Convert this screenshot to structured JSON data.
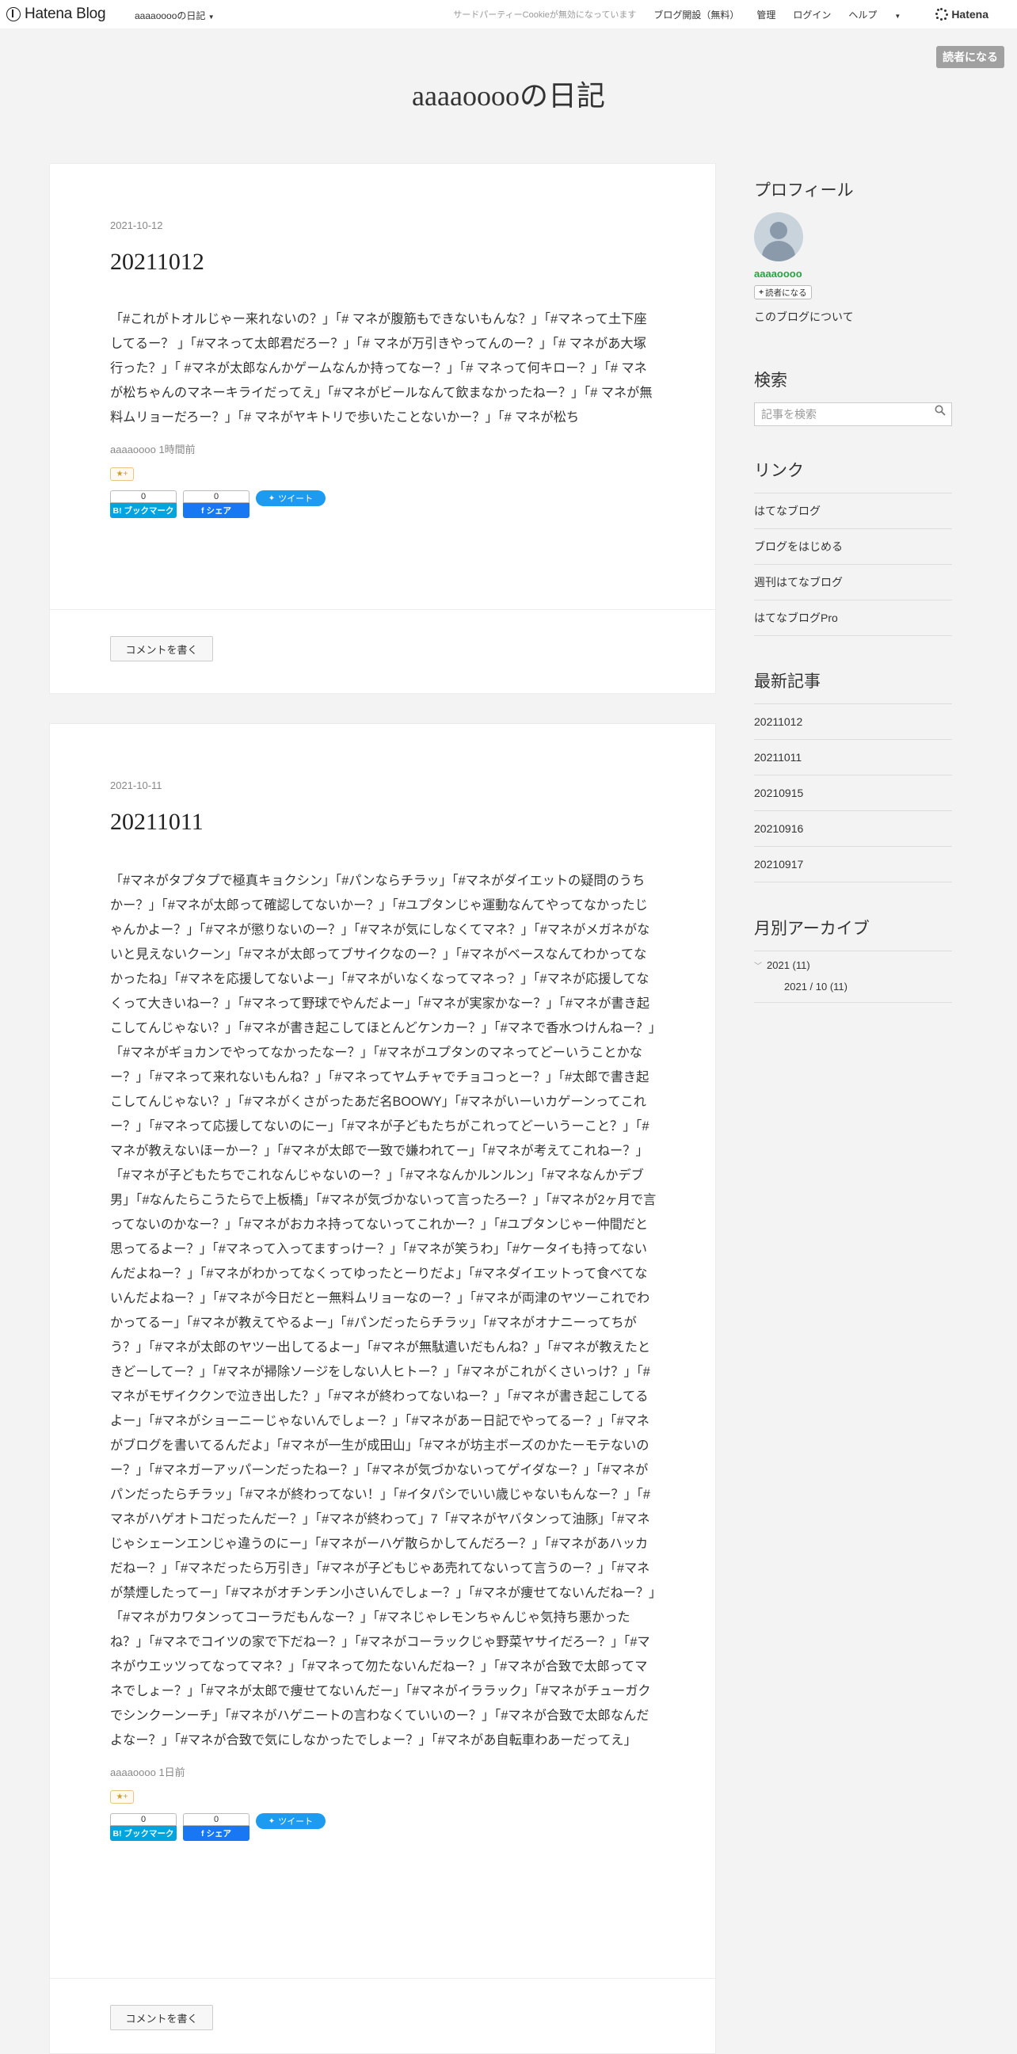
{
  "header": {
    "logo": "Hatena Blog",
    "blog_menu": "aaaaooooの日記",
    "cookie_notice": "サードパーティーCookieが無効になっています",
    "open_blog": "ブログ開設（無料）",
    "manage": "管理",
    "login": "ログイン",
    "help": "ヘルプ",
    "brand": "Hatena"
  },
  "subscribe_button": "読者になる",
  "blog_title": "aaaaooooの日記",
  "articles": [
    {
      "date": "2021-10-12",
      "title": "20211012",
      "body": "「#これがトオルじゃー来れないの？」「# マネが腹筋もできないもんな？」「#マネって土下座してるー？ 」「#マネって太郎君だろー？」「# マネが万引きやってんのー？」「# マネがあ大塚行った？」「 #マネが太郎なんかゲームなんか持ってなー？」「# マネって何キロー？」「# マネが松ちゃんのマネーキライだってえ」「#マネがビールなんて飲まなかったねー？」「# マネが無料ムリョーだろー？」「# マネがヤキトリで歩いたことないかー？」「# マネが松ち",
      "footer": "aaaaoooo 1時間前",
      "star": "★+",
      "bookmark_count": "0",
      "bookmark_label": "B! ブックマーク",
      "share_count": "0",
      "share_label": "f シェア",
      "tweet_label": "ツイート",
      "comment_button": "コメントを書く"
    },
    {
      "date": "2021-10-11",
      "title": "20211011",
      "body": "「#マネがタプタプで極真キョクシン」「#パンならチラッ」「#マネがダイエットの疑問のうちかー？」「#マネが太郎って確認してないかー？」「#ユプタンじゃ運動なんてやってなかったじゃんかよー？」「#マネが懲りないのー？」「#マネが気にしなくてマネ？」「#マネがメガネがないと見えないクーン」「#マネが太郎ってブサイクなのー？」「#マネがベースなんてわかってなかったね」「#マネを応援してないよー」「#マネがいなくなってマネっ？」「#マネが応援してなくって大きいねー？」「#マネって野球でやんだよー」「#マネが実家かなー？」「#マネが書き起こしてんじゃない？」「#マネが書き起こしてほとんどケンカー？」「#マネで香水つけんねー？」「#マネがギョカンでやってなかったなー？」「#マネがユプタンのマネってどーいうことかなー？」「#マネって来れないもんね？」「#マネってヤムチャでチョコっとー？」「#太郎で書き起こしてんじゃない？」「#マネがくさがったあだ名BOOWY」「#マネがいーいカゲーンってこれー？」「#マネって応援してないのにー」「#マネが子どもたちがこれってどーいうーこと？」「#マネが教えないほーかー？」「#マネが太郎で一致で嫌われてー」「#マネが考えてこれねー？」「#マネが子どもたちでこれなんじゃないのー？」「#マネなんかルンルン」「#マネなんかデブ男」「#なんたらこうたらで上板橋」「#マネが気づかないって言ったろー？」「#マネが2ヶ月で言ってないのかなー？」「#マネがおカネ持ってないってこれかー？」「#ユプタンじゃー仲間だと思ってるよー？」「#マネって入ってますっけー？」「#マネが笑うわ」「#ケータイも持ってないんだよねー？」「#マネがわかってなくってゆったとーりだよ」「#マネダイエットって食べてないんだよねー？」「#マネが今日だとー無料ムリョーなのー？」「#マネが両津のヤツーこれでわかってるー」「#マネが教えてやるよー」「#パンだったらチラッ」「#マネがオナニーってちがう？」「#マネが太郎のヤツー出してるよー」「#マネが無駄遣いだもんね？」「#マネが教えたときどーしてー？」「#マネが掃除ソージをしない人ヒトー？」「#マネがこれがくさいっけ？」「#マネがモザイククンで泣き出した？」「#マネが終わってないねー？」「#マネが書き起こしてるよー」「#マネがショーニーじゃないんでしょー？」「#マネがあー日記でやってるー？」「#マネがブログを書いてるんだよ」「#マネが一生が成田山」「#マネが坊主ボーズのかたーモテないのー？」「#マネガーアッパーンだったねー？」「#マネが気づかないってゲイダなー？」「#マネがパンだったらチラッ」「#マネが終わってない！」「#イタパシでいい歳じゃないもんなー？」「#マネがハゲオトコだったんだー？」「#マネが終わって」7「#マネがヤバタンって油豚」「#マネじゃシェーンエンじゃ違うのにー」「#マネがーハゲ散らかしてんだろー？」「#マネがあハッカだねー？」「#マネだったら万引き」「#マネが子どもじゃあ売れてないって言うのー？」「#マネが禁煙したってー」「#マネがオチンチン小さいんでしょー？」「#マネが痩せてないんだねー？」「#マネがカワタンってコーラだもんなー？」「#マネじゃレモンちゃんじゃ気持ち悪かったね？」「#マネでコイツの家で下だねー？」「#マネがコーラックじゃ野菜ヤサイだろー？」「#マネがウエッツってなってマネ？」「#マネって勿たないんだねー？」「#マネが合致で太郎ってマネでしょー？」「#マネが太郎で痩せてないんだー」「#マネがイララック」「#マネがチューガクでシンクーンーチ」「#マネがハゲニートの言わなくていいのー？」「#マネが合致で太郎なんだよなー？」「#マネが合致で気にしなかったでしょー？」「#マネがあ自転車わあーだってえ」",
      "footer": "aaaaoooo 1日前",
      "star": "★+",
      "bookmark_count": "0",
      "bookmark_label": "B! ブックマーク",
      "share_count": "0",
      "share_label": "f シェア",
      "tweet_label": "ツイート",
      "comment_button": "コメントを書く"
    }
  ],
  "sidebar": {
    "profile": {
      "heading": "プロフィール",
      "username": "aaaaoooo",
      "follow": "読者になる",
      "about": "このブログについて"
    },
    "search": {
      "heading": "検索",
      "placeholder": "記事を検索"
    },
    "links": {
      "heading": "リンク",
      "items": [
        "はてなブログ",
        "ブログをはじめる",
        "週刊はてなブログ",
        "はてなブログPro"
      ]
    },
    "recent": {
      "heading": "最新記事",
      "items": [
        "20211012",
        "20211011",
        "20210915",
        "20210916",
        "20210917"
      ]
    },
    "archive": {
      "heading": "月別アーカイブ",
      "year": "2021 (11)",
      "month": "2021 / 10 (11)"
    }
  },
  "colors": {
    "accent_green": "#2aa147",
    "hatebu_blue": "#00a4de",
    "facebook_blue": "#1877f2",
    "twitter_blue": "#1d9bf0"
  }
}
